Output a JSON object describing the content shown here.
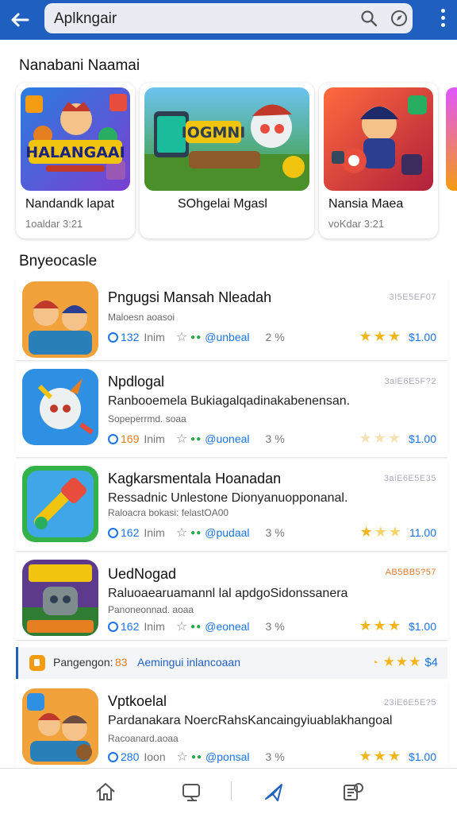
{
  "search": {
    "value": "Aplkngair"
  },
  "sections": {
    "featured_title": "Nanabani Naamai",
    "list_title": "Bnyeocasle"
  },
  "featured": [
    {
      "title": "Nandandk lapat",
      "subtitle": "1oaldar 3:21",
      "art_text": "HALANGAAI"
    },
    {
      "title": "SOhgelai Mgasl",
      "subtitle": "",
      "art_text": "IOGMNI"
    },
    {
      "title": "Nansia Maea",
      "subtitle": "voKdar 3:21",
      "art_text": ""
    }
  ],
  "apps": [
    {
      "name": "Pngugsi Mansah Nleadah",
      "desc": "",
      "small": "Maloesn aoasoi",
      "code": "3I5E5EF07",
      "downloads": "132",
      "unit": "Inim",
      "tag": "@unbeal",
      "pct": "2 %",
      "price": "$1.00",
      "stars": 3,
      "faded": 0
    },
    {
      "name": "Npdlogal",
      "desc": "Ranbooemela Bukiagalqadinakabenensan.",
      "small": "Sopeperrmd. soaa",
      "code": "3aiE6E5F?2",
      "downloads": "169",
      "unit": "Inim",
      "tag": "@uoneal",
      "pct": "3 %",
      "price": "$1.00",
      "stars": 3,
      "faded": 3
    },
    {
      "name": "Kagkarsmentala Hoanadan",
      "desc": "Ressadnic Unlestone Dionyanuopponanal.",
      "small": "Raloacra bokasi: felastOA00",
      "code": "3aiE6E5E35",
      "downloads": "162",
      "unit": "Inim",
      "tag": "@pudaal",
      "pct": "3 %",
      "price": "11.00",
      "stars": 3,
      "faded": 0
    },
    {
      "name": "UedNogad",
      "desc": "Raluoaearuamannl lal apdgoSidonssanera",
      "small": "Panoneonnad. aoaa",
      "code": "AB5BB5?57",
      "downloads": "162",
      "unit": "Inim",
      "tag": "@eoneal",
      "pct": "3 %",
      "price": "$1.00",
      "stars": 3,
      "faded": 0
    },
    {
      "name": "Vptkoelal",
      "desc": "Pardanakara NoercRahsKancaingyiuablakhangoal",
      "small": "Racoanard.aoaa",
      "code": "23iE6E5E?5",
      "downloads": "280",
      "unit": "Ioon",
      "tag": "@ponsal",
      "pct": "3 %",
      "price": "$1.00",
      "stars": 3,
      "faded": 0
    }
  ],
  "promo": {
    "label": "Pangengon:",
    "number": "83",
    "text": "Aemingui inlancoaan",
    "price": "$4"
  },
  "colors": {
    "brand": "#1f5fbf",
    "accent": "#1a73e8",
    "star": "#f2b51c",
    "price": "#1a73e8"
  },
  "icons": [
    "back-arrow-icon",
    "search-icon",
    "compass-icon",
    "more-vert-icon",
    "home-icon",
    "games-icon",
    "send-icon",
    "library-icon"
  ]
}
